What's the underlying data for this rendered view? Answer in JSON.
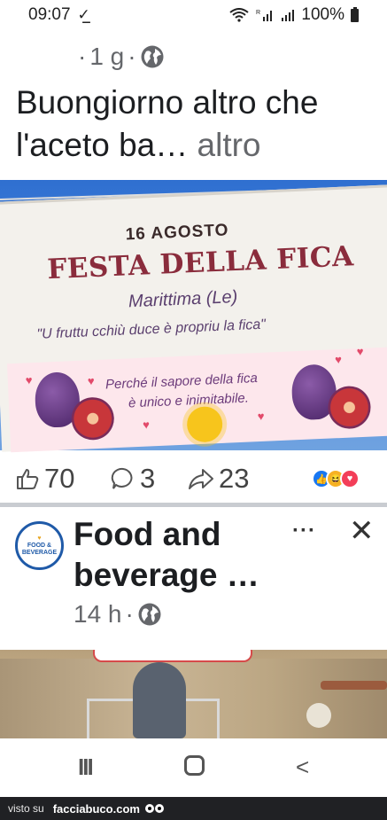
{
  "status_bar": {
    "time": "09:07",
    "battery": "100%"
  },
  "post1": {
    "age": "1 g",
    "text": "Buongiorno altro che l'aceto ba…",
    "see_more": "altro",
    "image_banner": {
      "date": "16 AGOSTO",
      "title": "FESTA DELLA FICA",
      "place": "Marittima (Le)",
      "quote": "\"U fruttu cchiù duce è propriu la fica\"",
      "line1": "Perché il sapore della fica",
      "line2": "è unico e inimitabile."
    },
    "likes": "70",
    "comments": "3",
    "shares": "23"
  },
  "post2": {
    "page_name": "Food and beverage …",
    "avatar_text": "FOOD & BEVERAGE",
    "age": "14 h",
    "more_options": "···",
    "close": "✕"
  },
  "nav": {
    "recents": "III",
    "back": "<"
  },
  "watermark": {
    "label": "visto su",
    "site": "facciabuco.com"
  }
}
